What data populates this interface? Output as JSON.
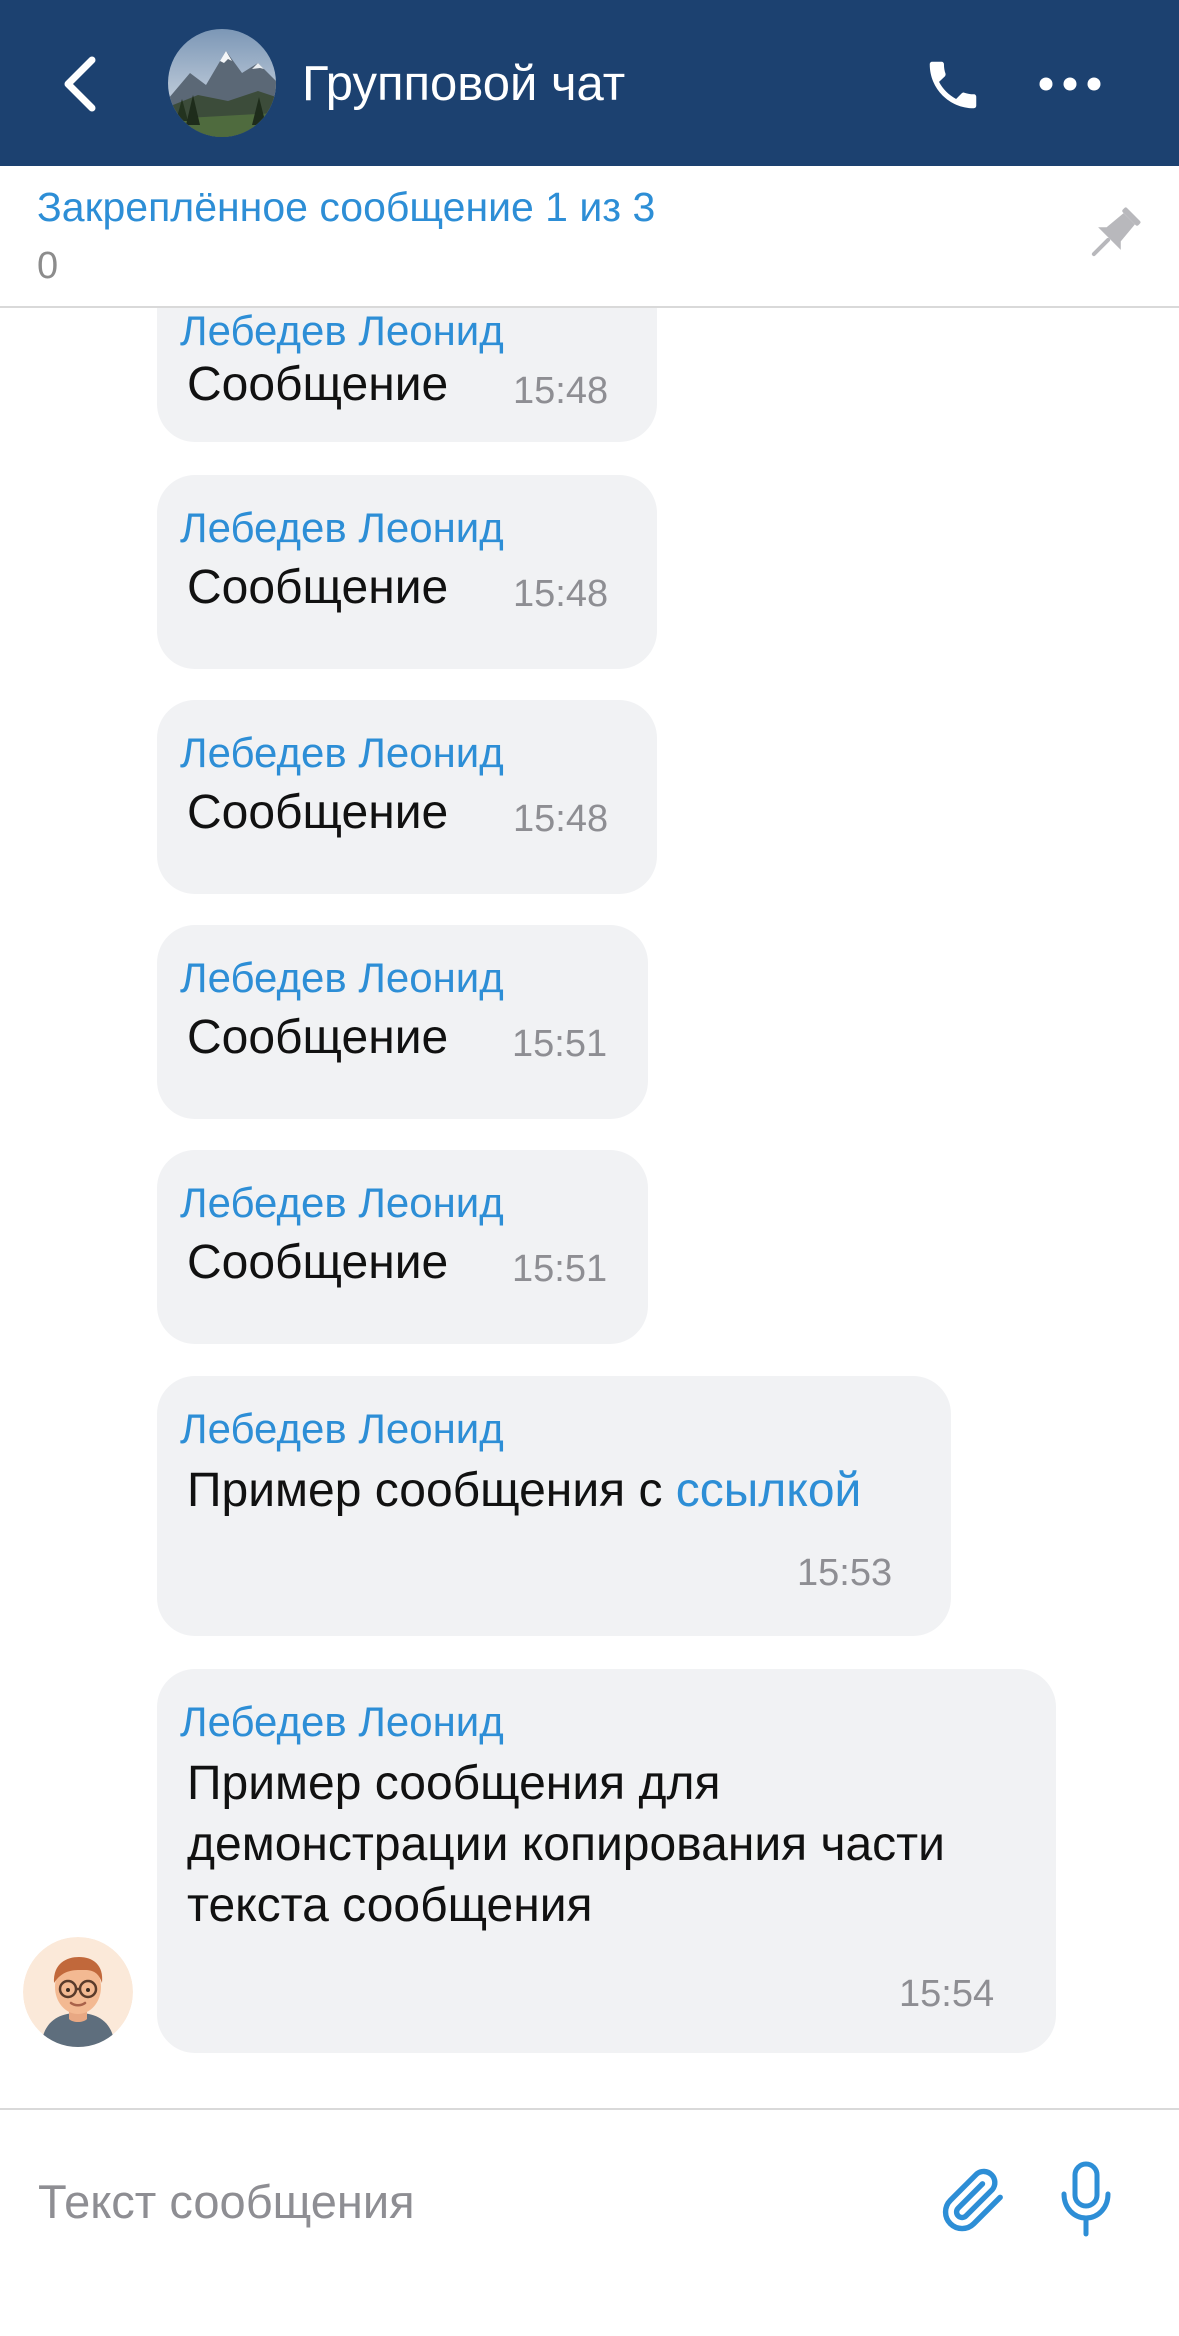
{
  "colors": {
    "header_background": "#1c4170",
    "accent_blue": "#2d8ed6",
    "bubble_background": "#f1f2f4",
    "time_gray": "#8e8e93"
  },
  "header": {
    "title": "Групповой чат",
    "back_icon": "chevron-left-icon",
    "call_icon": "phone-icon",
    "more_icon": "ellipsis-icon",
    "avatar": "mountain-landscape-avatar"
  },
  "pinned": {
    "title": "Закреплённое сообщение 1 из 3",
    "text": "0",
    "icon": "pin-icon"
  },
  "messages": [
    {
      "sender": "Лебедев Леонид",
      "text": "Сообщение",
      "time": "15:48"
    },
    {
      "sender": "Лебедев Леонид",
      "text": "Сообщение",
      "time": "15:48"
    },
    {
      "sender": "Лебедев Леонид",
      "text": "Сообщение",
      "time": "15:48"
    },
    {
      "sender": "Лебедев Леонид",
      "text": "Сообщение",
      "time": "15:51"
    },
    {
      "sender": "Лебедев Леонид",
      "text": "Сообщение",
      "time": "15:51"
    },
    {
      "sender": "Лебедев Леонид",
      "text": "Пример сообщения с ",
      "link": "ссылкой",
      "time": "15:53"
    },
    {
      "sender": "Лебедев Леонид",
      "text": "Пример сообщения для демонстрации копирования части текста сообщения",
      "time": "15:54"
    }
  ],
  "composer": {
    "placeholder": "Текст сообщения",
    "value": "",
    "attach_icon": "paperclip-icon",
    "mic_icon": "microphone-icon"
  }
}
